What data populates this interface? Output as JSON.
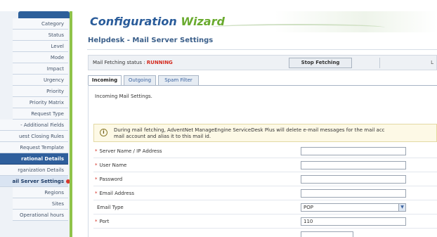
{
  "sidebar": {
    "items": [
      {
        "label": "Category",
        "style": "normal"
      },
      {
        "label": "Status",
        "style": "normal"
      },
      {
        "label": "Level",
        "style": "normal"
      },
      {
        "label": "Mode",
        "style": "normal"
      },
      {
        "label": "Impact",
        "style": "normal"
      },
      {
        "label": "Urgency",
        "style": "normal"
      },
      {
        "label": "Priority",
        "style": "normal"
      },
      {
        "label": "Priority Matrix",
        "style": "normal"
      },
      {
        "label": "Request Type",
        "style": "normal"
      },
      {
        "label": "- Additional Fields",
        "style": "full"
      },
      {
        "label": "uest Closing Rules",
        "style": "full"
      },
      {
        "label": "Request Template",
        "style": "full"
      },
      {
        "label": "rational Details",
        "style": "head"
      },
      {
        "label": "rganization Details",
        "style": "full"
      },
      {
        "label": "ail Server Settings",
        "style": "active"
      },
      {
        "label": "Regions",
        "style": "normal"
      },
      {
        "label": "Sites",
        "style": "normal"
      },
      {
        "label": "Operational hours",
        "style": "normal"
      }
    ]
  },
  "header": {
    "title_part1": "Configuration ",
    "title_part2": "Wizard"
  },
  "page": {
    "title": "Helpdesk - Mail Server Settings"
  },
  "status_bar": {
    "label": "Mail Fetching status : ",
    "value": "RUNNING",
    "stop_button": "Stop Fetching",
    "trail": "L"
  },
  "tabs": [
    {
      "label": "Incoming",
      "active": true
    },
    {
      "label": "Outgoing",
      "active": false
    },
    {
      "label": "Spam Filter",
      "active": false
    }
  ],
  "incoming": {
    "heading": "Incoming Mail Settings."
  },
  "info": {
    "icon": "info-icon",
    "line1": "During mail fetching, AdventNet ManageEngine ServiceDesk Plus will delete e-mail messages for the mail acc",
    "line2": "mail account and alias it to this mail id."
  },
  "form": {
    "rows": [
      {
        "label": "Server Name / IP Address",
        "required": "*",
        "value": ""
      },
      {
        "label": "User Name",
        "required": "*",
        "value": ""
      },
      {
        "label": "Password",
        "required": "*",
        "value": ""
      },
      {
        "label": "Email Address",
        "required": "*",
        "value": ""
      },
      {
        "label": "Email Type",
        "required": "",
        "value": "POP",
        "type": "select"
      },
      {
        "label": "Port",
        "required": "*",
        "value": "110"
      }
    ]
  },
  "colors": {
    "accent": "#2a5c9a",
    "wizard_green": "#6aab2f",
    "status_red": "#d32b1f"
  }
}
